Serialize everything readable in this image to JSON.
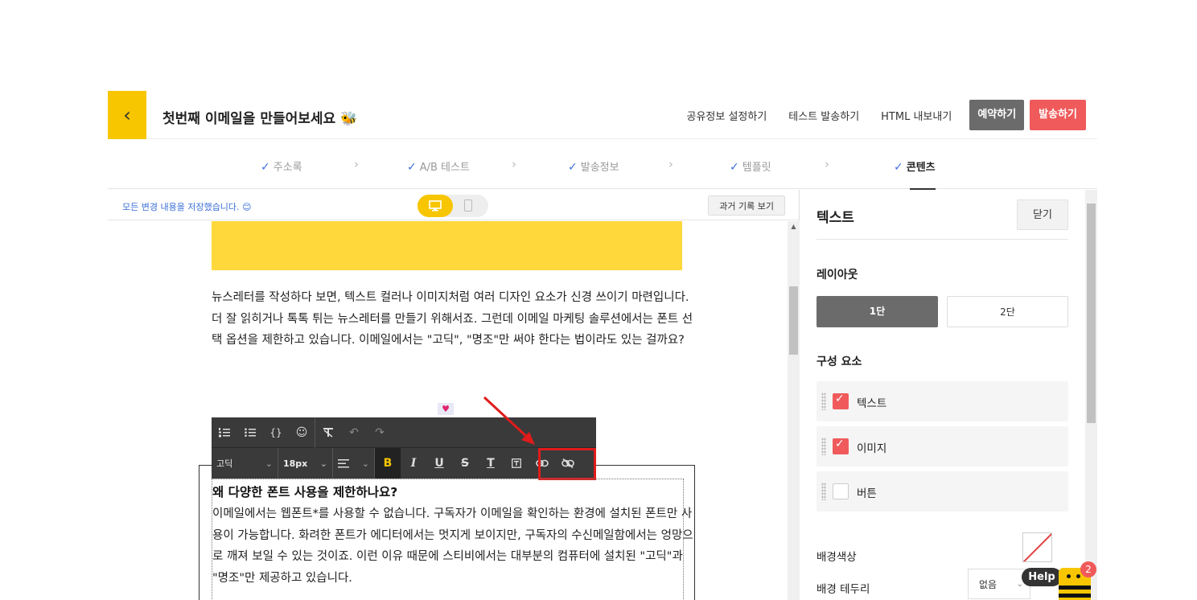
{
  "header": {
    "title": "첫번째 이메일을 만들어보세요 🐝",
    "links": [
      "공유정보 설정하기",
      "테스트 발송하기",
      "HTML 내보내기"
    ],
    "reserve_label": "예약하기",
    "send_label": "발송하기"
  },
  "steps": [
    "주소록",
    "A/B 테스트",
    "발송정보",
    "템플릿",
    "콘텐츠"
  ],
  "editor": {
    "saved_status": "모든 변경 내용을 저장했습니다. 😊",
    "history_label": "과거 기록 보기",
    "paragraph1": "뉴스레터를 작성하다 보면, 텍스트 컬러나 이미지처럼 여러 디자인 요소가 신경 쓰이기 마련입니다. 더 잘 읽히거나 톡톡 튀는 뉴스레터를 만들기 위해서죠. 그런데 이메일 마케팅 솔루션에서는 폰트 선택 옵션을 제한하고 있습니다. 이메일에서는 \"고딕\", \"명조\"만 써야 한다는 법이라도 있는 걸까요?",
    "heading": "왜 다양한 폰트 사용을 제한하나요?",
    "paragraph2": "이메일에서는 웹폰트*를 사용할 수 없습니다. 구독자가 이메일을 확인하는 환경에 설치된 폰트만 사용이 가능합니다. 화려한 폰트가 에디터에서는 멋지게 보이지만, 구독자의 수신메일함에서는 엉망으로 깨져 보일 수 있는 것이죠. 이런 이유 때문에 스티비에서는 대부분의 컴퓨터에 설치된 \"고딕\"과 \"명조\"만 제공하고 있습니다.",
    "toolbar": {
      "font": "고딕",
      "size": "18px"
    }
  },
  "panel": {
    "title": "텍스트",
    "close_label": "닫기",
    "layout_label": "레이아웃",
    "layout_options": [
      "1단",
      "2단"
    ],
    "components_label": "구성 요소",
    "components": [
      {
        "label": "텍스트",
        "checked": true
      },
      {
        "label": "이미지",
        "checked": true
      },
      {
        "label": "버튼",
        "checked": false
      }
    ],
    "bg_color_label": "배경색상",
    "border_label": "배경 테두리",
    "border_value": "없음"
  },
  "help": {
    "label": "Help",
    "badge": "2"
  },
  "colors": {
    "accent_yellow": "#f7c600",
    "send_red": "#f05a5a",
    "highlight_red": "#e01b1b"
  }
}
